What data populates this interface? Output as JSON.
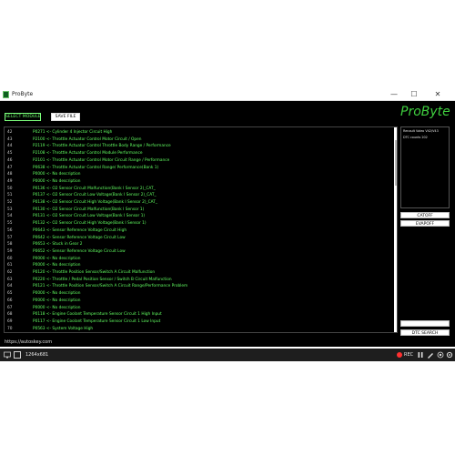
{
  "window": {
    "title": "ProByte",
    "min_glyph": "—",
    "max_glyph": "☐",
    "close_glyph": "✕"
  },
  "toolbar": {
    "select_module_label": "SELECT MODULE",
    "save_file_label": "SAVE FILE"
  },
  "logo": "ProByte",
  "dtc_list": [
    {
      "num": "42",
      "text": "P0271 <- Cylinder 4 Injector Circuit High"
    },
    {
      "num": "43",
      "text": "P2100 <- Throttle Actuator Control Motor Circuit / Open"
    },
    {
      "num": "44",
      "text": "P2119 <- Throttle Actuator Control Throttle Body Range / Performance"
    },
    {
      "num": "45",
      "text": "P2108 <- Throttle Actuator Control Module Performance"
    },
    {
      "num": "46",
      "text": "P2101 <- Throttle Actuator Control Motor Circuit Range / Performance"
    },
    {
      "num": "47",
      "text": "P0638 <- Throttle Actuator Control Range/ Performance(Bank 1)"
    },
    {
      "num": "48",
      "text": "P0000 <- No description"
    },
    {
      "num": "49",
      "text": "P0000 <- No description"
    },
    {
      "num": "50",
      "text": "P0136 <- O2 Sensor Circuit Malfunction(Bank I Sensor 2)_CAT_"
    },
    {
      "num": "51",
      "text": "P0137 <- O2 Sensor Circuit Low Voltage(Bank I Sensor 2)_CAT_"
    },
    {
      "num": "52",
      "text": "P0138 <- O2 Sensor Circuit High Voltage(Bank I Sensor 2)_CAT_"
    },
    {
      "num": "53",
      "text": "P0130 <- O2 Sensor Circuit Malfunction(Bank I Sensor 1)"
    },
    {
      "num": "54",
      "text": "P0131 <- O2 Sensor Circuit Low Voltage(Bank I Sensor 1)"
    },
    {
      "num": "55",
      "text": "P0132 <- O2 Sensor Circuit High Voltage(Bank I Sensor 1)"
    },
    {
      "num": "56",
      "text": "P0643 <- Sensor Reference Voltage Circuit High"
    },
    {
      "num": "57",
      "text": "P0642 <- Sensor Reference Voltage Circuit Low"
    },
    {
      "num": "58",
      "text": "P0653 <- Stuck in Gear 2"
    },
    {
      "num": "59",
      "text": "P0652 <- Sensor Reference Voltage Circuit Low"
    },
    {
      "num": "60",
      "text": "P0000 <- No description"
    },
    {
      "num": "61",
      "text": "P0000 <- No description"
    },
    {
      "num": "62",
      "text": "P0120 <- Throttle Position Sensor/Switch A Circuit Malfunction"
    },
    {
      "num": "63",
      "text": "P0220 <- Throttle / Pedal Position Sensor / Switch B Circuit Malfunction"
    },
    {
      "num": "64",
      "text": "P0121 <- Throttle Position Sensor/Switch A Circuit Range/Performance Problem"
    },
    {
      "num": "65",
      "text": "P0000 <- No description"
    },
    {
      "num": "66",
      "text": "P0000 <- No description"
    },
    {
      "num": "67",
      "text": "P0000 <- No description"
    },
    {
      "num": "68",
      "text": "P0118 <- Engine Coolant Temperature Sensor Circuit 1 High Input"
    },
    {
      "num": "69",
      "text": "P0117 <- Engine Coolant Temperature Sensor Circuit 1 Low Input"
    },
    {
      "num": "70",
      "text": "P0563 <- System Voltage High"
    }
  ],
  "info_panel": {
    "line1": "Renault Valeo V42/V43",
    "line2": "DTC counts 202"
  },
  "buttons": {
    "catoff": "CATOFF",
    "evapoff": "EVAPOFF",
    "dtc_search": "DTC SEARCH"
  },
  "url": "https://autoskey.com",
  "taskbar": {
    "resolution": "1264x681",
    "rec": "REC"
  },
  "colors": {
    "accent_green": "#62ff62",
    "logo_green": "#3fcf3f",
    "background": "#000000"
  }
}
